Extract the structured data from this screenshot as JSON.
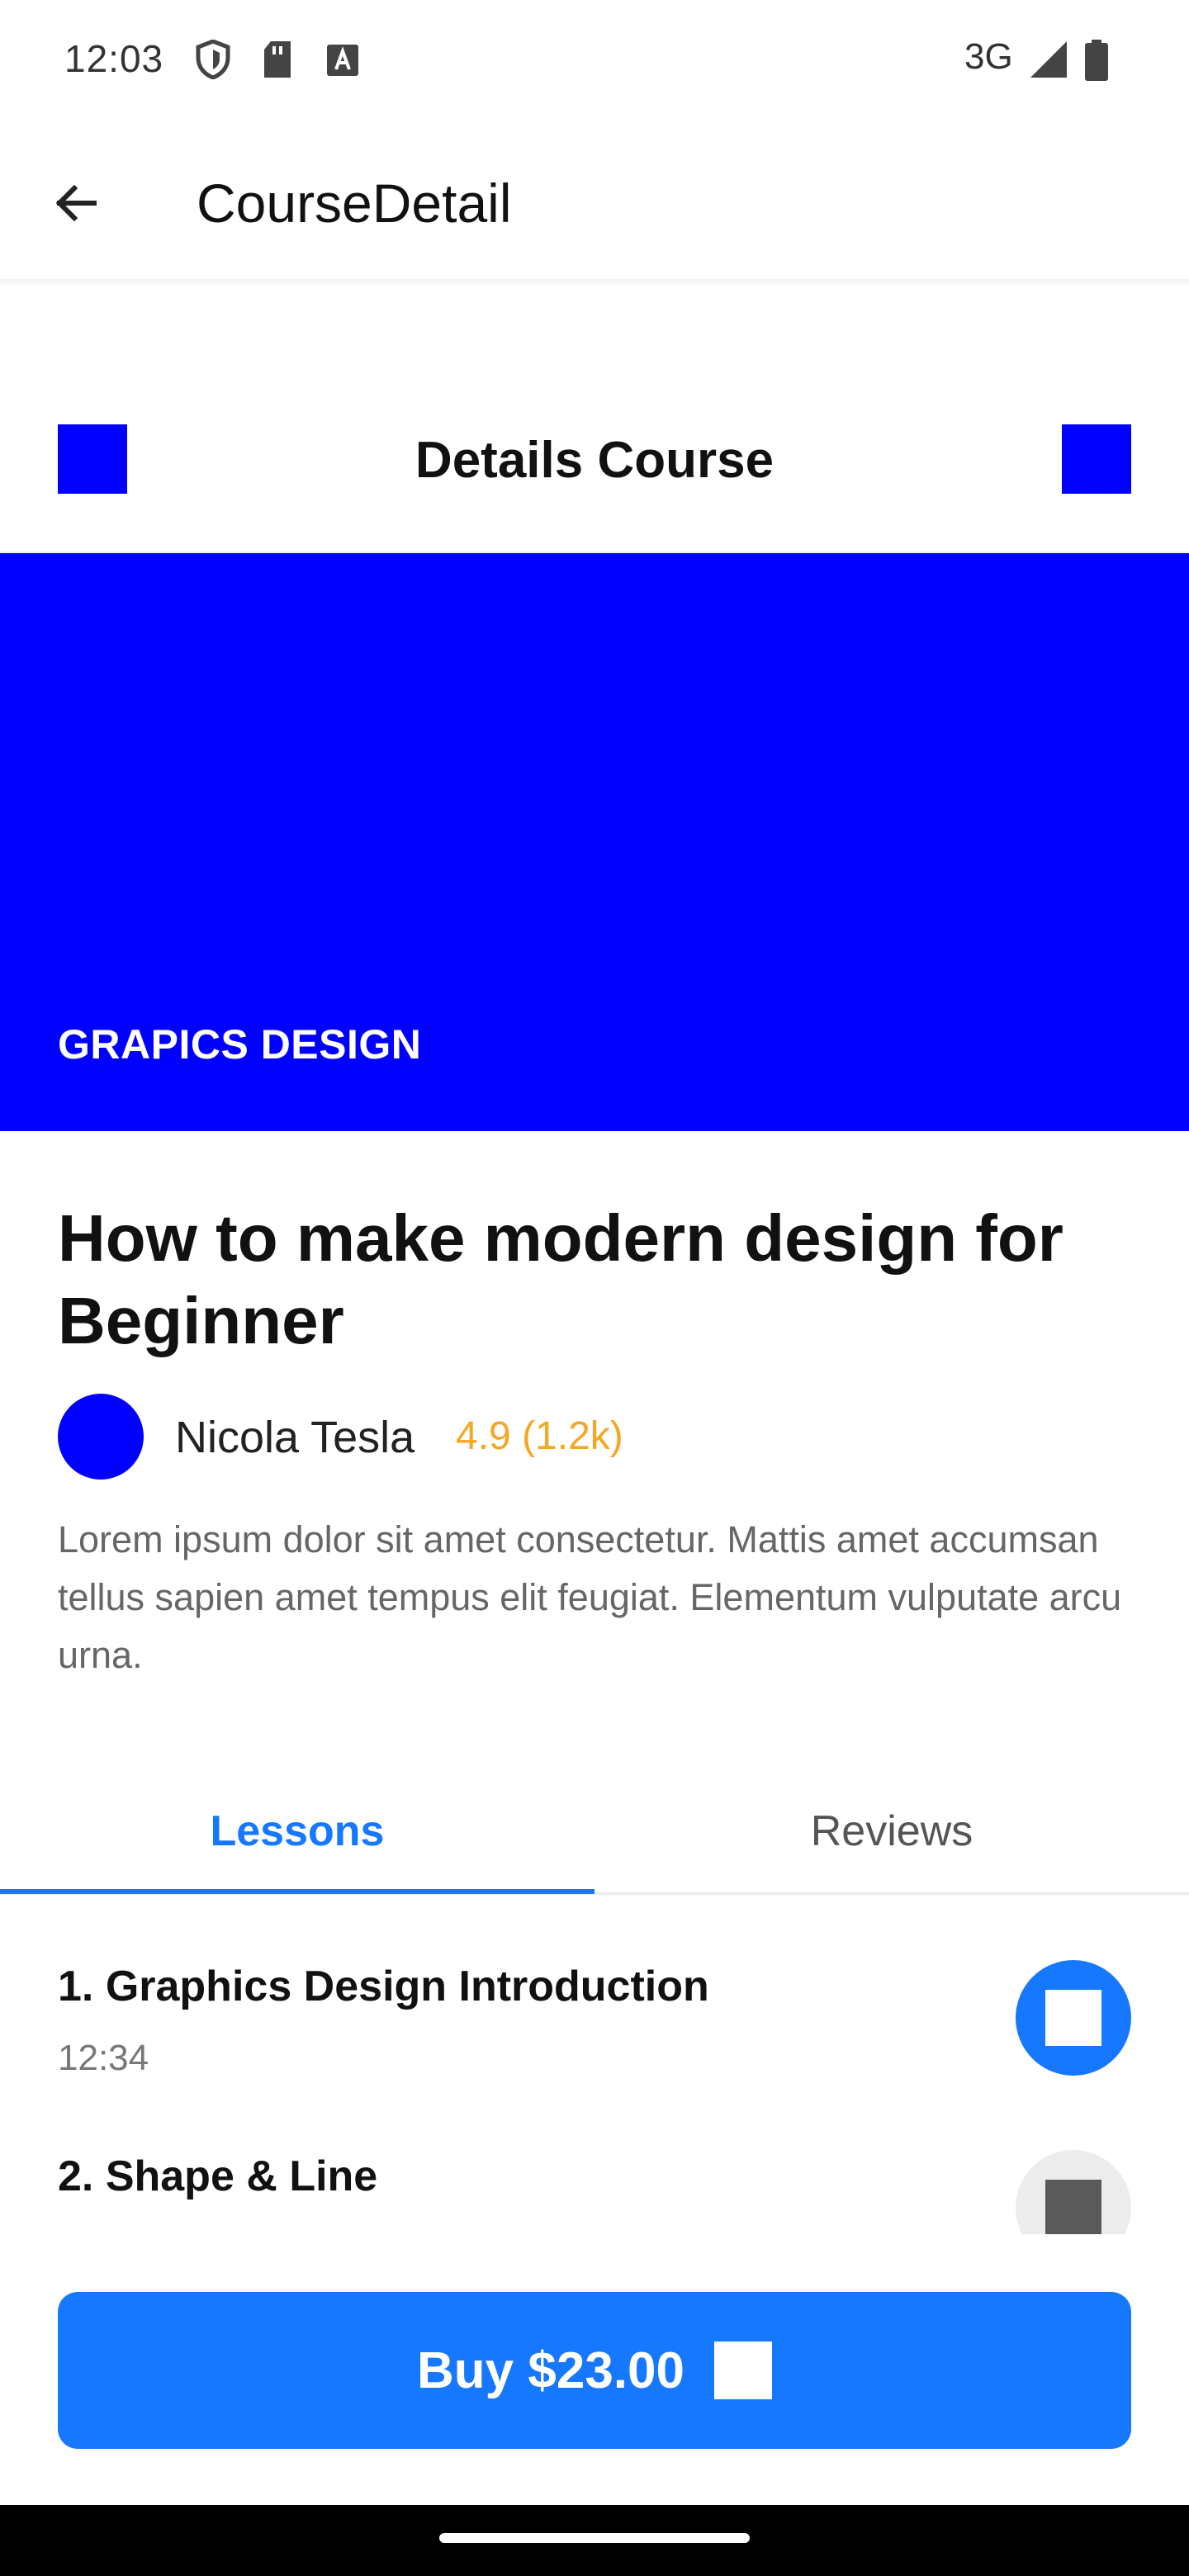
{
  "status_bar": {
    "time": "12:03",
    "network": "3G"
  },
  "app_bar": {
    "title": "CourseDetail"
  },
  "details_header": {
    "title": "Details Course"
  },
  "banner": {
    "category": "GRAPICS DESIGN",
    "color": "#0000ff"
  },
  "course": {
    "title": "How to make modern design for Beginner",
    "author": "Nicola Tesla",
    "rating": "4.9 (1.2k)",
    "description": "Lorem ipsum dolor sit amet consectetur. Mattis amet accumsan tellus sapien amet tempus elit feugiat. Elementum vulputate arcu urna."
  },
  "tabs": {
    "lessons": "Lessons",
    "reviews": "Reviews",
    "active": "Lessons"
  },
  "lessons": [
    {
      "title": "1. Graphics Design Introduction",
      "duration": "12:34",
      "state": "active"
    },
    {
      "title": "2. Shape & Line",
      "state": "locked"
    }
  ],
  "buy_button": {
    "label": "Buy $23.00"
  },
  "colors": {
    "accent": "#1677ff",
    "placeholder_blue": "#0000ff",
    "rating": "#f5a623"
  }
}
